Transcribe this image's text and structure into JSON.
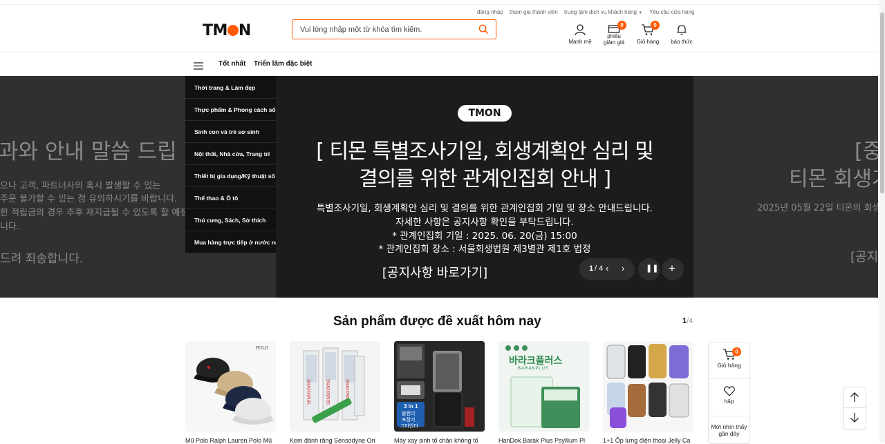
{
  "util_links": [
    "đăng nhập",
    "tham gia thành viên",
    "trung tâm dịch vụ khách hàng",
    "Yêu cầu cửa hàng"
  ],
  "logo": {
    "text_a": "TM",
    "text_b": "N"
  },
  "search": {
    "placeholder": "Vui lòng nhập một từ khóa tìm kiếm."
  },
  "header_icons": {
    "my": "Mạnh mẽ",
    "coupon_line1": "phiếu",
    "coupon_line2": "giảm giá",
    "coupon_badge": "0",
    "cart": "Giỏ hàng",
    "cart_badge": "0",
    "alarm": "báo thức"
  },
  "nav": {
    "best": "Tốt nhất",
    "exhibition": "Triển lãm đặc biệt"
  },
  "categories": [
    "Thời trang & Làm đẹp",
    "Thực phẩm & Phong cách sống",
    "Sinh con và trẻ sơ sinh",
    "Nội thất, Nhà cửa, Trang trí",
    "Thiết bị gia dụng/Kỹ thuật số",
    "Thể thao & Ô tô",
    "Thú cưng, Sách, Sở thích",
    "Mua hàng trực tiếp ở nước ngoài"
  ],
  "hero": {
    "logo_text": "TMON",
    "title_line1": "[ 티몬 특별조사기일, 회생계획안 심리 및",
    "title_line2": "결의를 위한 관계인집회 안내 ]",
    "text_line1": "특별조사기일, 회생계획안 심리 및 결의를 위한 관계인집회 기일 및 장소 안내드립니다.",
    "text_line2": "자세한 사항은 공지사항 확인을 부탁드립니다.",
    "text_line3": "* 관계인집회 기일 : 2025. 06. 20(금) 15:00",
    "text_line4": "* 관계인집회 장소 : 서울회생법원 제3별관 제1호 법정",
    "link": "[공지사항 바로가기]",
    "counter_current": "1",
    "counter_total": "/ 4",
    "left_ghost": {
      "title": "과와 안내 말씀 드립",
      "l1": "으나 고객, 파트너사의 혹시 발생할 수 있는",
      "l2": "주문 불가할 수 있는 점 유의하시기를 바랍니다.",
      "l3": "한 적립금의 경우 추후 재지급될 수 있도록 할 예정",
      "l4": "니다.",
      "l5": "드려 죄송합니다."
    },
    "right_ghost": {
      "t1": "[중",
      "t2": "티몬 회생기",
      "l1": "2025년 05월 22일 티몬의 회생",
      "l2": "[공지"
    }
  },
  "recommended": {
    "title": "Sản phẩm được đề xuất hôm nay",
    "page_current": "1",
    "page_total": "/4",
    "products": [
      {
        "name": "Mũ Polo Ralph Lauren Polo Mũ",
        "img_label": "POLO",
        "icon": "cap-image"
      },
      {
        "name": "Kem đánh răng Sensodyne Ori",
        "img_label": "SENSODYNE",
        "icon": "toothpaste-image"
      },
      {
        "name": "Máy xay sinh tố chân không tố",
        "img_label_1": "3 in 1",
        "img_label_2": "블렌더",
        "img_label_3": "포장기",
        "img_label_4": "그라인더",
        "icon": "blender-image"
      },
      {
        "name": "HanDok Barak Plus Psyllium Pl",
        "img_label_1": "바라크플러스",
        "img_label_2": "BARAKPLUS",
        "icon": "supplement-image"
      },
      {
        "name": "1+1 Ốp lưng điện thoại Jelly Ca",
        "icon": "phone-case-image"
      }
    ]
  },
  "sidebox": {
    "cart": "Giỏ hàng",
    "cart_badge": "0",
    "wish": "hấp",
    "recent_line1": "Mới nhìn thấy",
    "recent_line2": "gần đây"
  },
  "colors": {
    "accent": "#ff5a00",
    "hero_bg": "#1c1c1c",
    "dropdown_bg": "#111111"
  }
}
